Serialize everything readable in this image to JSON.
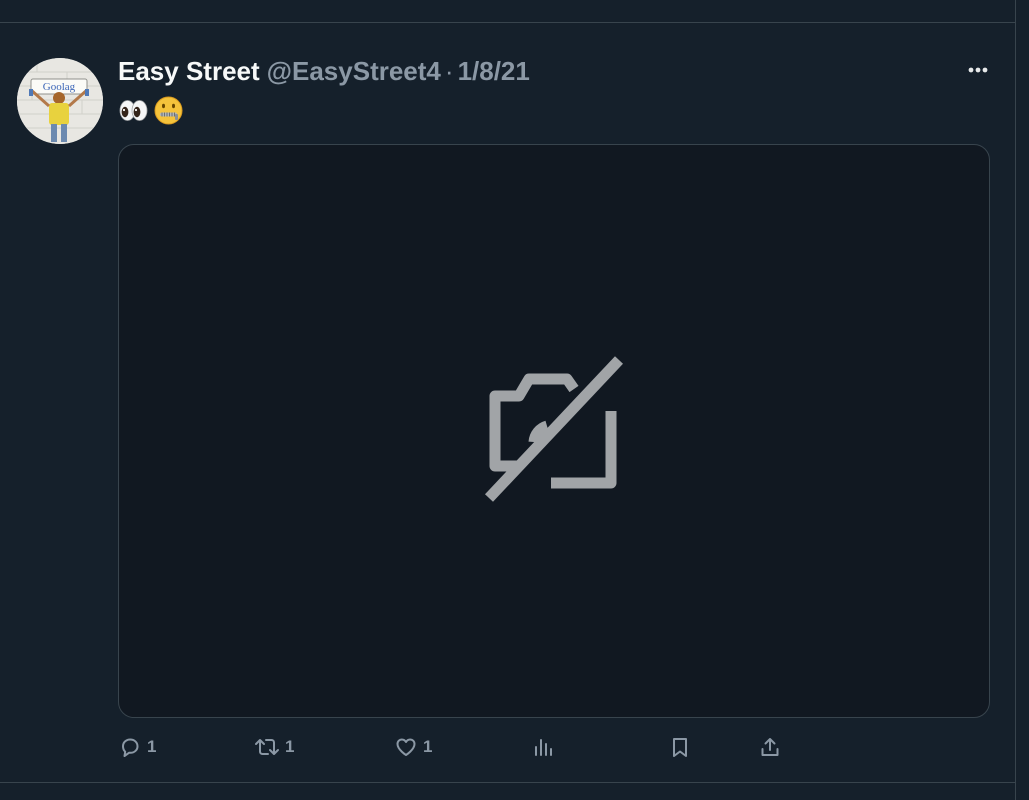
{
  "tweet": {
    "display_name": "Easy Street",
    "handle": "@EasyStreet4",
    "separator": "·",
    "date": "1/8/21",
    "text_emojis": [
      "eyes-emoji",
      "zipper-mouth-emoji"
    ],
    "avatar_sign_text": "Goolag",
    "media_state": "image-unavailable",
    "actions": {
      "reply_count": "1",
      "retweet_count": "1",
      "like_count": "1"
    }
  },
  "icons": {
    "more": "more-icon",
    "reply": "reply-icon",
    "retweet": "retweet-icon",
    "like": "heart-icon",
    "views": "analytics-icon",
    "bookmark": "bookmark-icon",
    "share": "share-icon",
    "media_placeholder": "camera-off-icon"
  },
  "colors": {
    "background": "#15202b",
    "media_background": "#111821",
    "border": "#38444d",
    "secondary_text": "#8b98a5",
    "primary_text": "#f7f9f9"
  }
}
